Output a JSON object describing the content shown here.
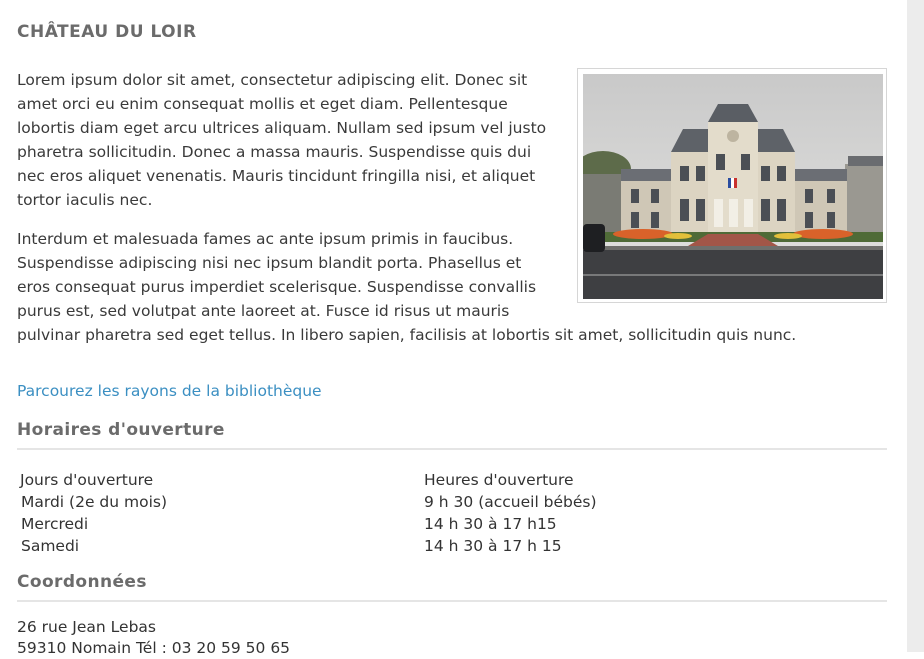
{
  "page": {
    "title": "CHÂTEAU DU LOIR",
    "paragraphs": [
      "Lorem ipsum dolor sit amet, consectetur adipiscing elit. Donec sit amet orci eu enim consequat mollis et eget diam. Pellentesque lobortis diam eget arcu ultrices aliquam. Nullam sed ipsum vel justo pharetra sollicitudin. Donec a massa mauris. Suspendisse quis dui nec eros aliquet venenatis. Mauris tincidunt fringilla nisi, et aliquet tortor iaculis nec.",
      "Interdum et malesuada fames ac ante ipsum primis in faucibus. Suspendisse adipiscing nisi nec ipsum blandit porta. Phasellus et eros consequat purus imperdiet scelerisque. Suspendisse convallis purus est, sed volutpat ante laoreet at. Fusce id risus ut mauris pulvinar pharetra sed eget tellus. In libero sapien, facilisis at lobortis sit amet, sollicitudin quis nunc."
    ],
    "browse_link": "Parcourez les rayons de la bibliothèque"
  },
  "hours": {
    "heading": "Horaires d'ouverture",
    "col_days": "Jours d'ouverture",
    "col_hours": "Heures d'ouverture",
    "rows": [
      {
        "day": "Mardi (2e du mois)",
        "hours": "9 h 30 (accueil bébés)"
      },
      {
        "day": "Mercredi",
        "hours": "14 h 30 à 17 h15"
      },
      {
        "day": "Samedi",
        "hours": "14 h 30 à 17 h 15"
      }
    ]
  },
  "contact": {
    "heading": "Coordonnées",
    "line1": "26 rue Jean Lebas",
    "line2": "59310 Nomain Tél : 03 20 59 50 65"
  },
  "colors": {
    "link": "#3b8fc2",
    "heading": "#6b6b6b"
  }
}
